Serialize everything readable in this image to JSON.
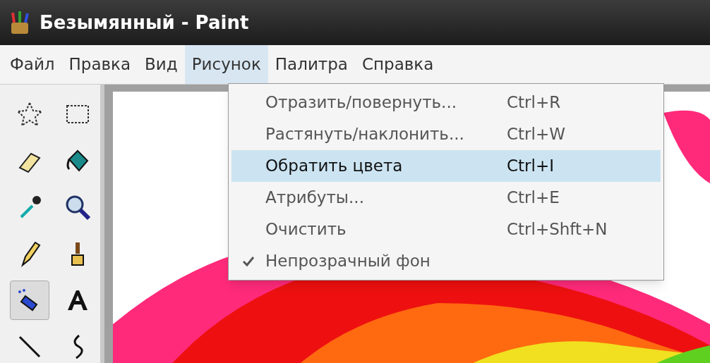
{
  "window": {
    "title": "Безымянный - Paint"
  },
  "menu_bar": [
    {
      "label": "Файл",
      "selected": false
    },
    {
      "label": "Правка",
      "selected": false
    },
    {
      "label": "Вид",
      "selected": false
    },
    {
      "label": "Рисунок",
      "selected": true
    },
    {
      "label": "Палитра",
      "selected": false
    },
    {
      "label": "Справка",
      "selected": false
    }
  ],
  "dropdown": [
    {
      "label": "Отразить/повернуть...",
      "shortcut": "Ctrl+R",
      "selected": false,
      "checked": false
    },
    {
      "label": "Растянуть/наклонить...",
      "shortcut": "Ctrl+W",
      "selected": false,
      "checked": false
    },
    {
      "label": "Обратить цвета",
      "shortcut": "Ctrl+I",
      "selected": true,
      "checked": false
    },
    {
      "label": "Атрибуты...",
      "shortcut": "Ctrl+E",
      "selected": false,
      "checked": false
    },
    {
      "label": "Очистить",
      "shortcut": "Ctrl+Shft+N",
      "selected": false,
      "checked": false
    },
    {
      "label": "Непрозрачный фон",
      "checked": true,
      "selected": false
    }
  ],
  "tools": [
    {
      "kind": "free-select",
      "selected": false
    },
    {
      "kind": "rect-select",
      "selected": false
    },
    {
      "kind": "eraser",
      "selected": false
    },
    {
      "kind": "fill",
      "selected": false
    },
    {
      "kind": "picker",
      "selected": false
    },
    {
      "kind": "magnifier",
      "selected": false
    },
    {
      "kind": "pencil",
      "selected": false
    },
    {
      "kind": "brush",
      "selected": false
    },
    {
      "kind": "airbrush",
      "selected": true
    },
    {
      "kind": "text",
      "selected": false
    },
    {
      "kind": "line",
      "selected": false
    },
    {
      "kind": "curve",
      "selected": false
    }
  ]
}
